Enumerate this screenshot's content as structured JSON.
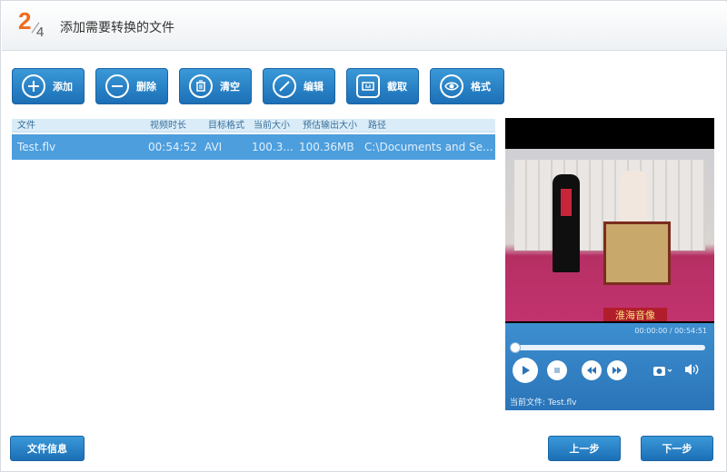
{
  "header": {
    "step_current": "2",
    "step_total": "4",
    "title": "添加需要转换的文件"
  },
  "toolbar": [
    {
      "label": "添加",
      "icon": "plus-icon"
    },
    {
      "label": "删除",
      "icon": "minus-icon"
    },
    {
      "label": "清空",
      "icon": "trash-icon"
    },
    {
      "label": "编辑",
      "icon": "pencil-icon"
    },
    {
      "label": "截取",
      "icon": "clip-icon"
    },
    {
      "label": "格式",
      "icon": "format-icon"
    }
  ],
  "file_list": {
    "columns": [
      "文件",
      "视频时长",
      "目标格式",
      "当前大小",
      "预估输出大小",
      "路径"
    ],
    "rows": [
      {
        "file": "Test.flv",
        "duration": "00:54:52",
        "target_format": "AVI",
        "current_size": "100.3...",
        "estimated_size": "100.36MB",
        "path": "C:\\Documents and Se..."
      }
    ]
  },
  "preview": {
    "time": "00:00:00 / 00:54:51",
    "progress": 0,
    "current_file": "当前文件: Test.flv",
    "caption": "淮海音像"
  },
  "footer": {
    "file_info": "文件信息",
    "prev": "上一步",
    "next": "下一步"
  },
  "colors": {
    "accent": "#2a74b8",
    "step": "#ef6c1e",
    "row_selected": "#4d9edd"
  }
}
